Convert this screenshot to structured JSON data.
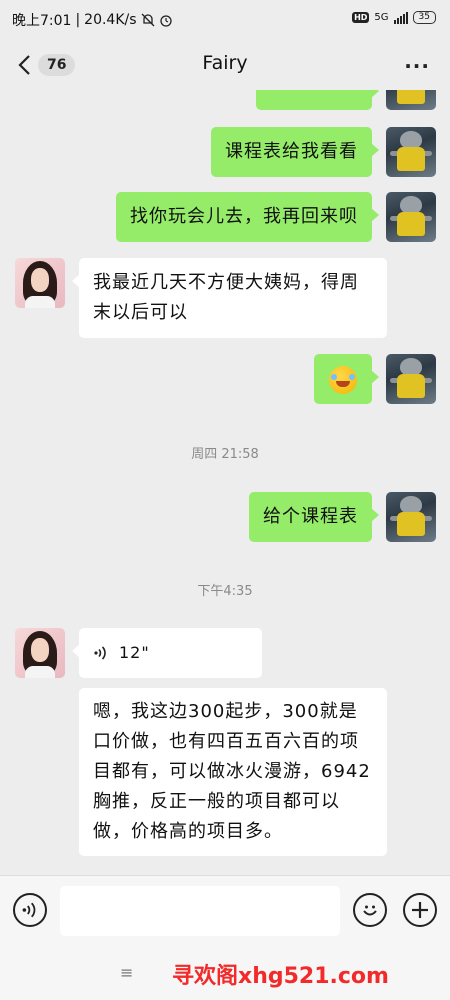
{
  "status_bar": {
    "time": "晚上7:01",
    "speed": "20.4K/s",
    "network_type": "5G",
    "battery": "35",
    "hd_label": "HD"
  },
  "nav": {
    "unread_count": "76",
    "title": "Fairy"
  },
  "messages": [
    {
      "from": "me",
      "text": "课程表给我看看"
    },
    {
      "from": "me",
      "text": "找你玩会儿去，我再回来呗"
    },
    {
      "from": "her",
      "text": "我最近几天不方便大姨妈，得周末以后可以"
    },
    {
      "from": "me",
      "emoji": "laughing-crying-emoji"
    },
    {
      "type": "time",
      "text": "周四 21:58"
    },
    {
      "from": "me",
      "text": "给个课程表"
    },
    {
      "type": "time",
      "text": "下午4:35"
    },
    {
      "from": "her",
      "voice_duration": "12\""
    },
    {
      "from": "her",
      "text": "嗯，我这边300起步，300就是口价做，也有四百五百六百的项目都有，可以做冰火漫游，6942胸推，反正一般的项目都可以做，价格高的项目多。"
    }
  ],
  "bottom": {
    "watermark": "寻欢阁xhg521.com",
    "menu_glyph": "≡"
  }
}
